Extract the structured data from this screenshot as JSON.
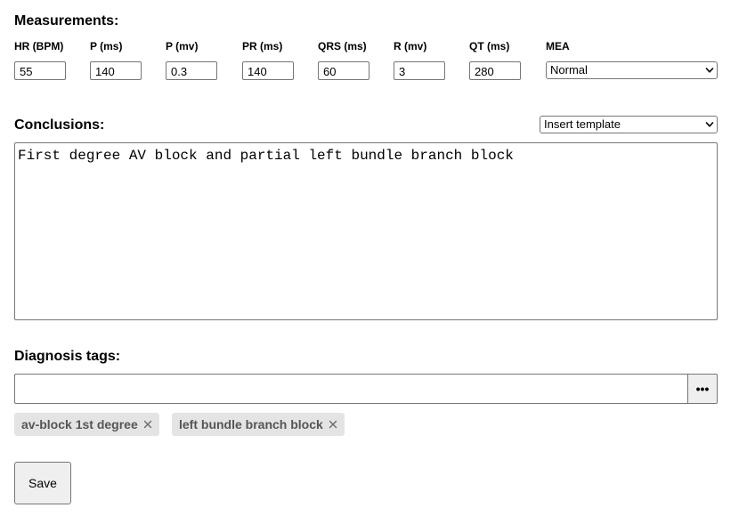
{
  "measurements": {
    "title": "Measurements:",
    "fields": [
      {
        "label": "HR (BPM)",
        "value": "55"
      },
      {
        "label": "P (ms)",
        "value": "140"
      },
      {
        "label": "P (mv)",
        "value": "0.3"
      },
      {
        "label": "PR (ms)",
        "value": "140"
      },
      {
        "label": "QRS (ms)",
        "value": "60"
      },
      {
        "label": "R (mv)",
        "value": "3"
      },
      {
        "label": "QT (ms)",
        "value": "280"
      }
    ],
    "mea": {
      "label": "MEA",
      "selected": "Normal"
    }
  },
  "conclusions": {
    "title": "Conclusions:",
    "template_select": "Insert template",
    "text": "First degree AV block and partial left bundle branch block"
  },
  "diagnosis": {
    "title": "Diagnosis tags:",
    "input_value": "",
    "more_label": "•••",
    "tags": [
      {
        "label": "av-block 1st degree"
      },
      {
        "label": "left bundle branch block"
      }
    ]
  },
  "actions": {
    "save_label": "Save"
  }
}
